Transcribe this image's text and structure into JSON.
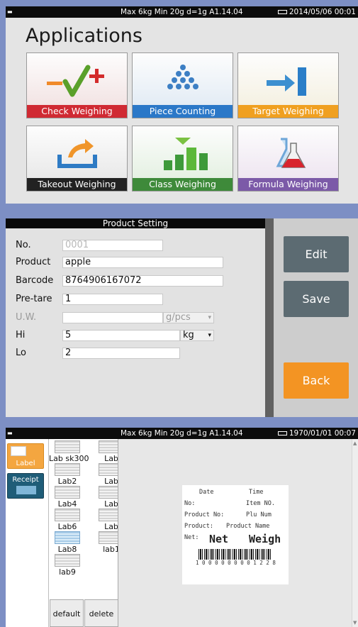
{
  "top_status": {
    "spec": "Max 6kg  Min 20g  d=1g  A1.14.04",
    "datetime": "2014/05/06  00:01"
  },
  "applications": {
    "title": "Applications",
    "tiles": [
      {
        "label": "Check Weighing",
        "label_color": "#d02a33"
      },
      {
        "label": "Piece Counting",
        "label_color": "#2b78c8"
      },
      {
        "label": "Target Weighing",
        "label_color": "#f0a020"
      },
      {
        "label": "Takeout  Weighing",
        "label_color": "#222222"
      },
      {
        "label": "Class  Weighing",
        "label_color": "#3e8a3a"
      },
      {
        "label": "Formula  Weighing",
        "label_color": "#7c5aa8"
      }
    ]
  },
  "product_setting": {
    "title": "Product Setting",
    "fields": [
      {
        "label": "No.",
        "value": "0001"
      },
      {
        "label": "Product",
        "value": "apple"
      },
      {
        "label": "Barcode",
        "value": "8764906167072"
      },
      {
        "label": "Pre-tare",
        "value": "1"
      },
      {
        "label": "U.W.",
        "value": "",
        "unit": "g/pcs"
      },
      {
        "label": "Hi",
        "value": "5",
        "unit": "kg"
      },
      {
        "label": "Lo",
        "value": "2"
      }
    ],
    "buttons": {
      "edit": "Edit",
      "save": "Save",
      "back": "Back"
    }
  },
  "label_screen": {
    "status": {
      "spec": "Max 6kg  Min 20g  d=1g  A1.14.04",
      "datetime": "1970/01/01  00:07"
    },
    "side_tabs": [
      "Label",
      "Receipt"
    ],
    "files": [
      "Lab sk300",
      "Lab",
      "Lab2",
      "Lab",
      "Lab4",
      "Lab",
      "Lab6",
      "Lab",
      "Lab8",
      "lab1",
      "lab9"
    ],
    "buttons": {
      "default": "default",
      "delete": "delete"
    },
    "preview": {
      "date": "Date",
      "time": "Time",
      "no": "No:",
      "item_no": "Item NO.",
      "product_no": "Product No:",
      "plu_num": "Plu Num",
      "product": "Product:",
      "product_name": "Product Name",
      "net_label": "Net:",
      "net_big": "Net",
      "weigh_big": "Weigh",
      "barcode_digits": "1 0 0 0 0 0 0 0 0 1 2 2 8"
    }
  }
}
